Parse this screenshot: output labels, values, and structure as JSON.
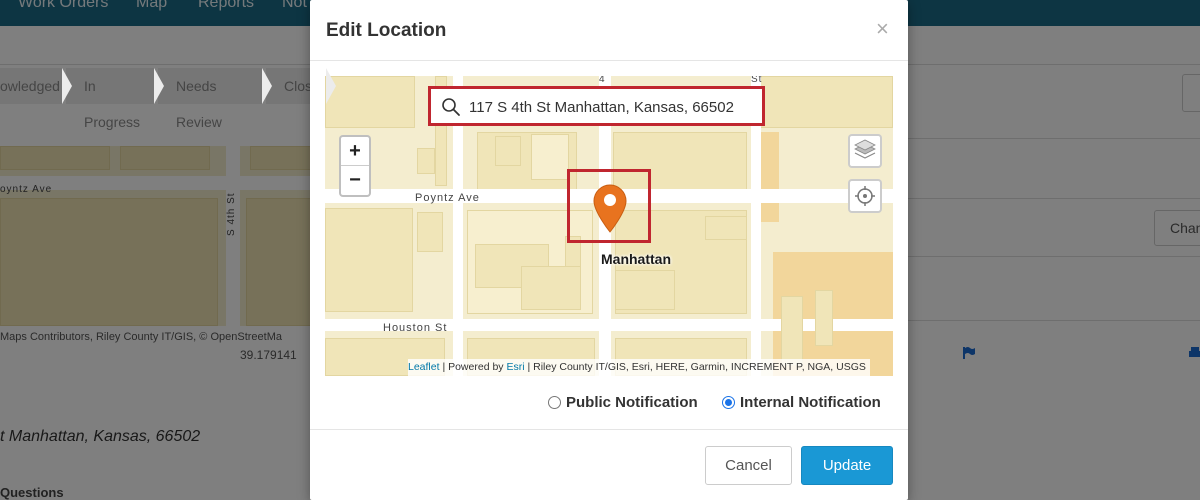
{
  "nav": {
    "items": [
      "Work Orders",
      "Map",
      "Reports",
      "Not"
    ]
  },
  "steps": [
    "owledged",
    "In Progress",
    "Needs Review",
    "Close"
  ],
  "background": {
    "map_street_1": "oyntz Ave",
    "map_street_2": "S 4th St",
    "attribution": "Maps Contributors, Riley County IT/GIS, © OpenStreetMa",
    "coords": "39.179141",
    "address": "t Manhattan, Kansas, 66502",
    "questions": "Questions",
    "chart_btn": "Chan"
  },
  "modal": {
    "title": "Edit Location",
    "close": "×",
    "search": {
      "value": "117 S 4th St Manhattan, Kansas, 66502"
    },
    "map": {
      "zoom_in": "+",
      "zoom_out": "−",
      "streets": {
        "poyntz": "Poyntz Ave",
        "houston": "Houston St",
        "fourth_a": "4",
        "fourth_b": "St"
      },
      "city_label": "Manhattan",
      "attribution": {
        "leaflet": "Leaflet",
        "powered_by": " | Powered by ",
        "esri": "Esri",
        "rest": " | Riley County IT/GIS, Esri, HERE, Garmin, INCREMENT P, NGA, USGS"
      }
    },
    "notifications": {
      "public": {
        "label": "Public Notification",
        "checked": false
      },
      "internal": {
        "label": "Internal Notification",
        "checked": true
      }
    },
    "footer": {
      "cancel": "Cancel",
      "update": "Update"
    }
  },
  "colors": {
    "nav": "#1b6a87",
    "accent": "#1a98d5",
    "highlight": "#c0262f",
    "pin": "#e8731f"
  }
}
